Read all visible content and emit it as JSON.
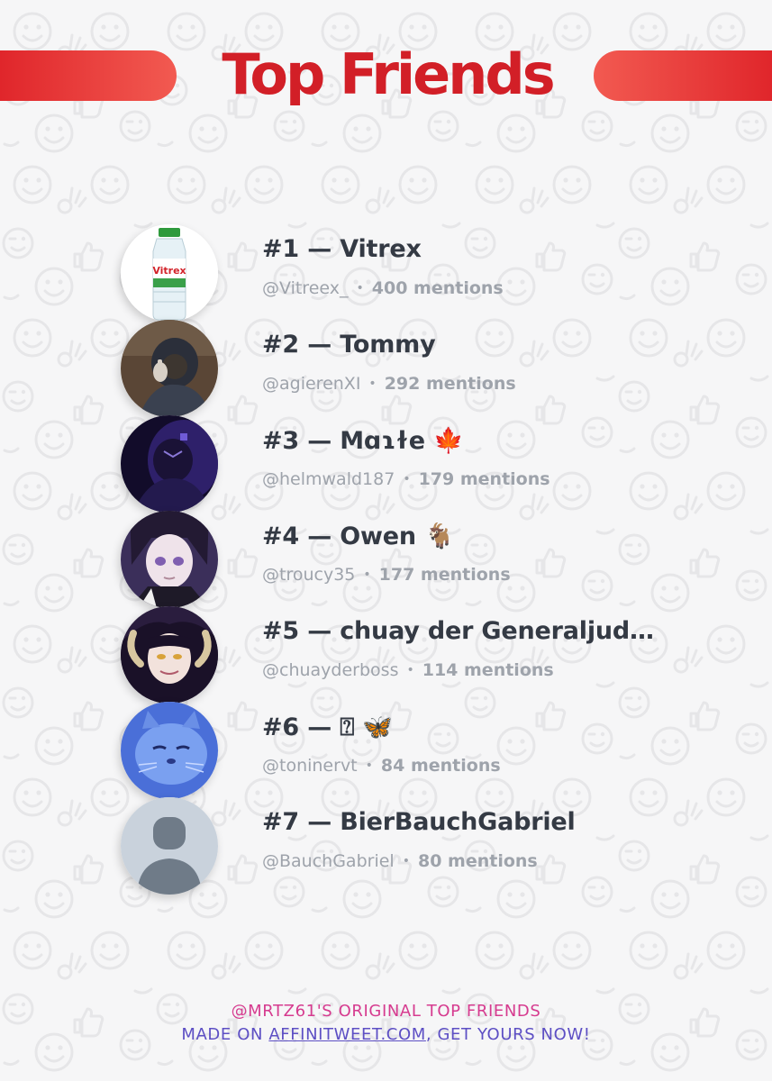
{
  "header": {
    "title": "Top Friends",
    "accent_color": "#d21f27"
  },
  "friends": [
    {
      "rank": "#1",
      "separator": "—",
      "display_name": "Vitrex",
      "handle": "@Vitreex_",
      "mentions": "400 mentions",
      "avatar": "water-bottle-photo"
    },
    {
      "rank": "#2",
      "separator": "—",
      "display_name": "Tommy",
      "handle": "@agierenXI",
      "mentions": "292 mentions",
      "avatar": "hooded-person-photo"
    },
    {
      "rank": "#3",
      "separator": "—",
      "display_name": "Mɑɿɫe 🍁",
      "handle": "@helmwald187",
      "mentions": "179 mentions",
      "avatar": "dark-purple-figure-photo"
    },
    {
      "rank": "#4",
      "separator": "—",
      "display_name": "Owen 🐐",
      "handle": "@troucy35",
      "mentions": "177 mentions",
      "avatar": "anime-character"
    },
    {
      "rank": "#5",
      "separator": "—",
      "display_name": "chuay der Generaljud…",
      "handle": "@chuayderboss",
      "mentions": "114 mentions",
      "avatar": "anime-horned-character"
    },
    {
      "rank": "#6",
      "separator": "—",
      "display_name": "⍰ 🦋",
      "handle": "@toninervt",
      "mentions": "84 mentions",
      "avatar": "blue-cat-photo"
    },
    {
      "rank": "#7",
      "separator": "—",
      "display_name": "BierBauchGabriel",
      "handle": "@BauchGabriel",
      "mentions": "80 mentions",
      "avatar": "default-user-silhouette"
    }
  ],
  "footer": {
    "line1": "@MRTZ61'S ORIGINAL TOP FRIENDS",
    "line2_prefix": "MADE ON ",
    "link_text": "AFFINITWEET.COM",
    "line2_suffix": ", GET YOURS NOW!"
  },
  "colors": {
    "background": "#f6f6f7",
    "name_text": "#343a44",
    "meta_text": "#9ea3ab",
    "footer_line1": "#d63b8f",
    "footer_line2": "#5d4fc4"
  }
}
